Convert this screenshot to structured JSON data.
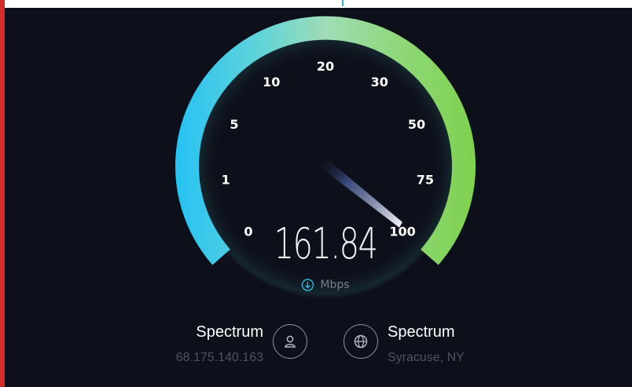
{
  "gauge": {
    "scale_labels": [
      "0",
      "1",
      "5",
      "10",
      "20",
      "30",
      "50",
      "75",
      "100"
    ],
    "needle_position_fraction": 1.0,
    "arc_gradient": [
      "#29c3f2",
      "#63d4d8",
      "#9fdcb5",
      "#8dd86f",
      "#7fd14f"
    ]
  },
  "result": {
    "speed_value": "161.84",
    "unit_label": "Mbps",
    "unit_icon": "download-arrow-icon"
  },
  "client": {
    "name": "Spectrum",
    "ip_address": "68.175.140.163",
    "icon": "user-icon"
  },
  "server": {
    "name": "Spectrum",
    "location": "Syracuse, NY",
    "icon": "globe-icon"
  },
  "colors": {
    "background": "#0d0f1a",
    "accent": "#2eb5e0",
    "left_edge": "#d42b2b"
  }
}
